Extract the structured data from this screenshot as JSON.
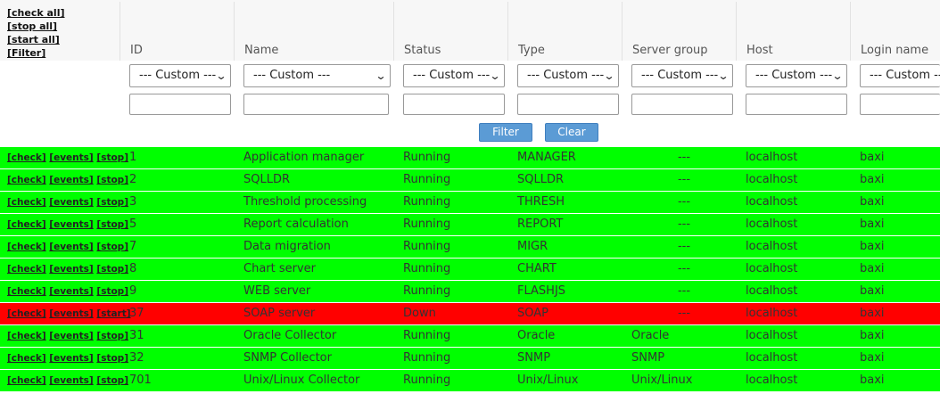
{
  "bulk_actions": {
    "check_all": "[check all]",
    "stop_all": "[stop all]",
    "start_all": "[start all]",
    "filter": "[Filter]"
  },
  "columns": {
    "id": "ID",
    "name": "Name",
    "status": "Status",
    "type": "Type",
    "server_group": "Server group",
    "host": "Host",
    "login_name": "Login name"
  },
  "filters": {
    "select_value": "--- Custom ---",
    "filter_button": "Filter",
    "clear_button": "Clear"
  },
  "row_actions": {
    "check": "[check]",
    "events": "[events]",
    "stop": "[stop]",
    "start": "[start]"
  },
  "status_colors": {
    "running": "#00ff00",
    "down": "#ff0000"
  },
  "rows": [
    {
      "id": "1",
      "name": "Application manager",
      "status": "Running",
      "type": "MANAGER",
      "server_group": "---",
      "host": "localhost",
      "login": "baxi",
      "action": "[stop]"
    },
    {
      "id": "2",
      "name": "SQLLDR",
      "status": "Running",
      "type": "SQLLDR",
      "server_group": "---",
      "host": "localhost",
      "login": "baxi",
      "action": "[stop]"
    },
    {
      "id": "3",
      "name": "Threshold processing",
      "status": "Running",
      "type": "THRESH",
      "server_group": "---",
      "host": "localhost",
      "login": "baxi",
      "action": "[stop]"
    },
    {
      "id": "5",
      "name": "Report calculation",
      "status": "Running",
      "type": "REPORT",
      "server_group": "---",
      "host": "localhost",
      "login": "baxi",
      "action": "[stop]"
    },
    {
      "id": "7",
      "name": "Data migration",
      "status": "Running",
      "type": "MIGR",
      "server_group": "---",
      "host": "localhost",
      "login": "baxi",
      "action": "[stop]"
    },
    {
      "id": "8",
      "name": "Chart server",
      "status": "Running",
      "type": "CHART",
      "server_group": "---",
      "host": "localhost",
      "login": "baxi",
      "action": "[stop]"
    },
    {
      "id": "9",
      "name": "WEB server",
      "status": "Running",
      "type": "FLASHJS",
      "server_group": "---",
      "host": "localhost",
      "login": "baxi",
      "action": "[stop]"
    },
    {
      "id": "37",
      "name": "SOAP server",
      "status": "Down",
      "type": "SOAP",
      "server_group": "---",
      "host": "localhost",
      "login": "baxi",
      "action": "[start]"
    },
    {
      "id": "31",
      "name": "Oracle Collector",
      "status": "Running",
      "type": "Oracle",
      "server_group": "Oracle",
      "host": "localhost",
      "login": "baxi",
      "action": "[stop]"
    },
    {
      "id": "32",
      "name": "SNMP Collector",
      "status": "Running",
      "type": "SNMP",
      "server_group": "SNMP",
      "host": "localhost",
      "login": "baxi",
      "action": "[stop]"
    },
    {
      "id": "701",
      "name": "Unix/Linux Collector",
      "status": "Running",
      "type": "Unix/Linux",
      "server_group": "Unix/Linux",
      "host": "localhost",
      "login": "baxi",
      "action": "[stop]"
    }
  ]
}
